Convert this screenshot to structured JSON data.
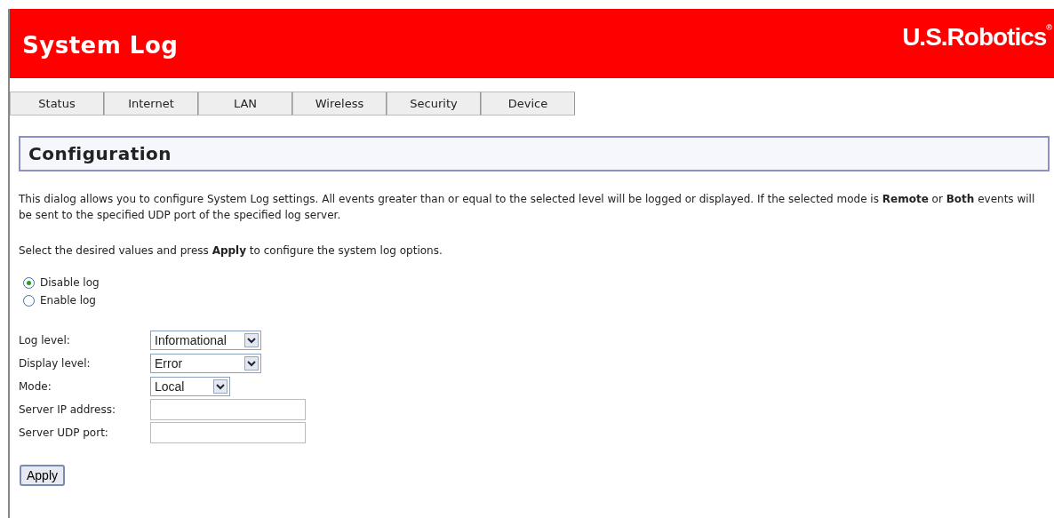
{
  "header": {
    "title": "System Log",
    "logo": "U.S.Robotics",
    "logo_mark": "®"
  },
  "tabs": [
    {
      "label": "Status"
    },
    {
      "label": "Internet"
    },
    {
      "label": "LAN"
    },
    {
      "label": "Wireless"
    },
    {
      "label": "Security"
    },
    {
      "label": "Device"
    }
  ],
  "section_title": "Configuration",
  "description": "This dialog allows you to configure System Log settings. All events greater than or equal to the selected level will be logged or displayed. If the selected mode is **Remote** or **Both** events will be sent to the specified UDP port of the specified log server.",
  "instruction": "Select the desired values and press **Apply** to configure the system log options.",
  "log_options": [
    {
      "label": "Disable log",
      "selected": true
    },
    {
      "label": "Enable log",
      "selected": false
    }
  ],
  "fields": [
    {
      "kind": "select",
      "label": "Log level:",
      "value": "Informational"
    },
    {
      "kind": "select",
      "label": "Display level:",
      "value": "Error"
    },
    {
      "kind": "short_select",
      "label": "Mode:",
      "value": "Local"
    },
    {
      "kind": "text",
      "label": "Server IP address:"
    },
    {
      "kind": "text",
      "label": "Server UDP port:"
    }
  ],
  "apply_button": "Apply"
}
